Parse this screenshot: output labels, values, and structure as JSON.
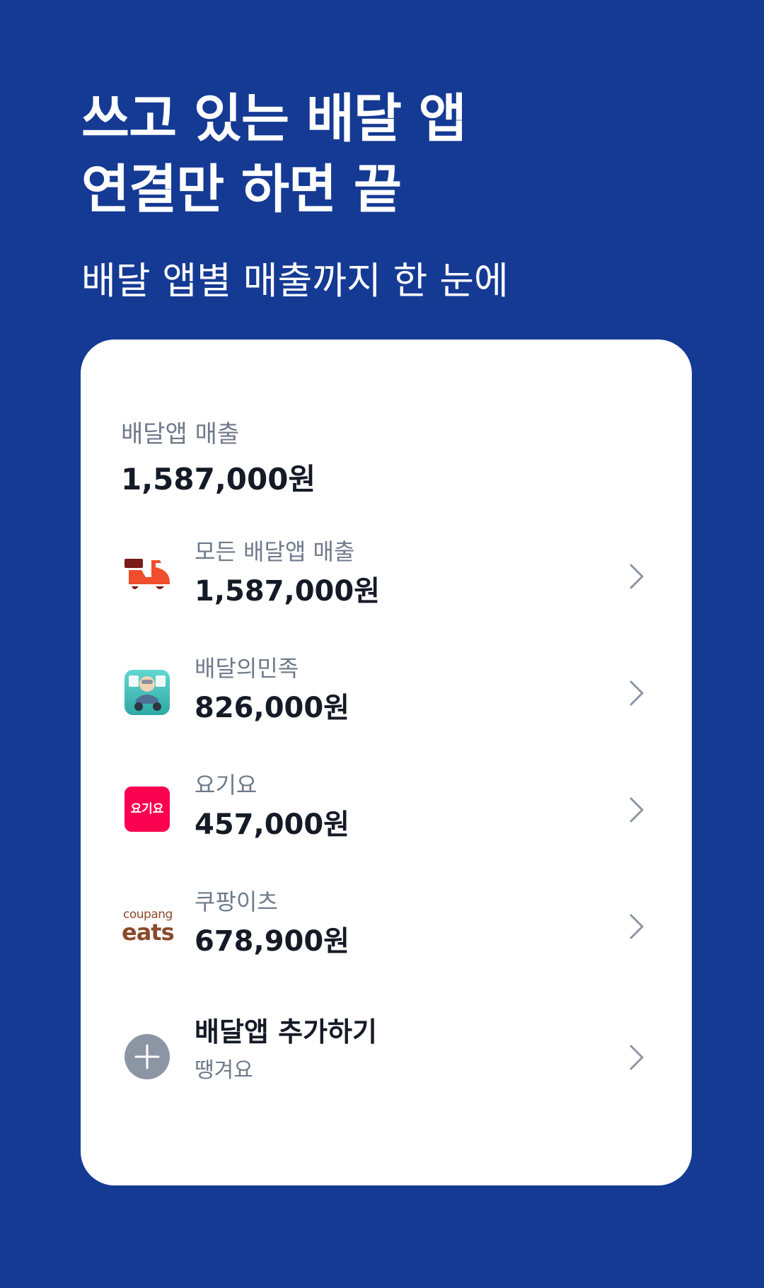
{
  "header": {
    "headline_line1": "쓰고 있는 배달 앱",
    "headline_line2": "연결만 하면 끝",
    "subheadline": "배달 앱별 매출까지 한 눈에"
  },
  "summary": {
    "label": "배달앱 매출",
    "value": "1,587,000원"
  },
  "apps": [
    {
      "label": "모든 배달앱 매출",
      "amount": "1,587,000원",
      "icon": "scooter-icon"
    },
    {
      "label": "배달의민족",
      "amount": "826,000원",
      "icon": "baemin-logo-icon"
    },
    {
      "label": "요기요",
      "amount": "457,000원",
      "icon": "yogiyo-logo-icon",
      "logo_text": "요기요"
    },
    {
      "label": "쿠팡이츠",
      "amount": "678,900원",
      "icon": "coupang-eats-logo-icon",
      "logo_text_top": "coupang",
      "logo_text_bottom": "eats"
    }
  ],
  "add_app": {
    "title": "배달앱 추가하기",
    "subtitle": "땡겨요",
    "icon": "plus-icon"
  },
  "colors": {
    "background": "#153a94",
    "card": "#ffffff",
    "primary_text": "#151b26",
    "secondary_text": "#6f7a8a",
    "yogiyo_red": "#fa0050",
    "scooter_orange": "#f04e2c"
  }
}
